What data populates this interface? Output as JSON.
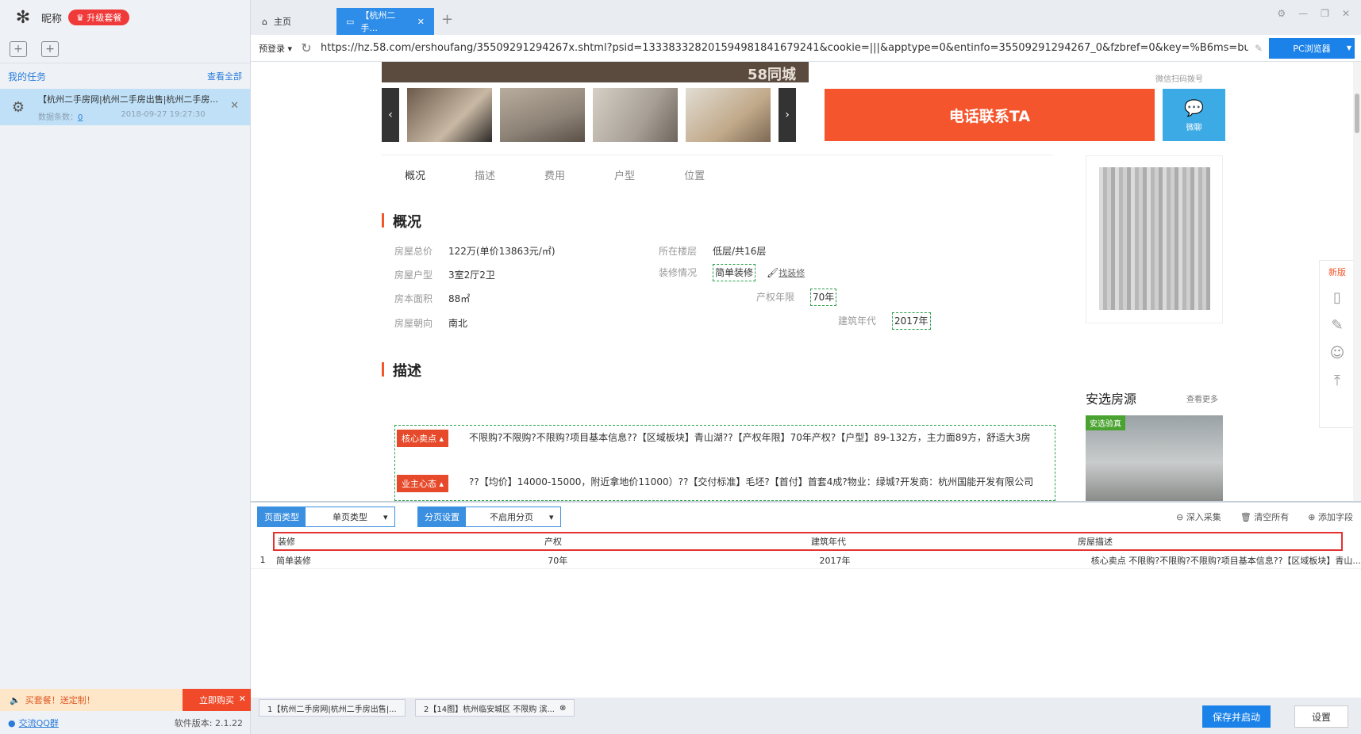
{
  "sidebar": {
    "nickname": "昵称",
    "upgrade": "升级套餐",
    "my_tasks": "我的任务",
    "view_all": "查看全部",
    "task": {
      "title": "【杭州二手房网|杭州二手房出售|杭州二手房...",
      "count_label": "数据条数：",
      "count": "0",
      "time": "2018-09-27 19:27:30"
    },
    "promo": "买套餐！送定制！",
    "buy_now": "立即购买",
    "qq_group": "交流QQ群",
    "version": "软件版本: 2.1.22"
  },
  "tabs": {
    "home": "主页",
    "active": "【杭州二手..."
  },
  "address": {
    "prelogin": "预登录",
    "url": "https://hz.58.com/ershoufang/35509291294267x.shtml?psid=133383328201594981841679241&cookie=|||&apptype=0&entinfo=35509291294267_0&fzbref=0&key=%B6ms=busitim",
    "browser_mode": "PC浏览器"
  },
  "web": {
    "watermark": "58同城",
    "scan_text": "微信扫码拨号",
    "call_button": "电话联系TA",
    "wechat_label": "微聊",
    "nav": [
      "概况",
      "描述",
      "费用",
      "户型",
      "位置"
    ],
    "overview_title": "概况",
    "fields": {
      "total_price_label": "房屋总价",
      "total_price": "122万(单价13863元/㎡)",
      "layout_label": "房屋户型",
      "layout": "3室2厅2卫",
      "area_label": "房本面积",
      "area": "88㎡",
      "orientation_label": "房屋朝向",
      "orientation": "南北",
      "floor_label": "所在楼层",
      "floor": "低层/共16层",
      "decor_label": "装修情况",
      "decor": "简单装修",
      "find_decor": "找装修",
      "property_label": "产权年限",
      "property": "70年",
      "built_label": "建筑年代",
      "built": "2017年"
    },
    "desc_title": "描述",
    "tag_core": "核心卖点",
    "tag_owner": "业主心态",
    "desc_line1": "不限购?不限购?不限购?项目基本信息??【区域板块】青山湖??【产权年限】70年产权?【户型】89-132方，主力面89方，舒适大3房",
    "desc_line2": "??【均价】14000-15000，附近拿地价11000）??【交付标准】毛坯?【首付】首套4成?物业：绿城?开发商：杭州国能开发有限公司",
    "anxuan_title": "安选房源",
    "anxuan_more": "查看更多",
    "anxuan_tag": "安选验真",
    "float_new": "新版"
  },
  "collector": {
    "page_type_label": "页面类型",
    "page_type_value": "单页类型",
    "pagination_label": "分页设置",
    "pagination_value": "不启用分页",
    "deep_collect": "深入采集",
    "clear_all": "清空所有",
    "add_field": "添加字段",
    "columns": [
      "装修",
      "产权",
      "建筑年代",
      "房屋描述"
    ],
    "row": {
      "index": "1",
      "cells": [
        "简单装修",
        "70年",
        "2017年",
        "核心卖点 不限购?不限购?不限购?项目基本信息??【区域板块】青山..."
      ]
    }
  },
  "bottom": {
    "page_tab1": "1【杭州二手房网|杭州二手房出售|...",
    "page_tab2": "2【14图】杭州临安城区 不限购 滨...",
    "save_start": "保存并启动",
    "settings": "设置"
  },
  "colors": {
    "accent": "#1a82e8",
    "call": "#f4552c",
    "highlight": "#e63131"
  }
}
